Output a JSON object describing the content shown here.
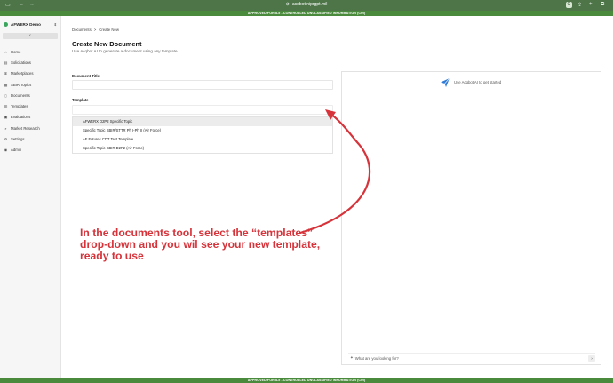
{
  "browser": {
    "url": "acqbot.niprgpt.mil",
    "icons": [
      "sidebar-icon",
      "back-icon",
      "forward-icon",
      "lock-icon",
      "extension-icon",
      "share-icon",
      "new-tab-icon",
      "tabs-icon"
    ],
    "extension_letter": "G"
  },
  "banner": {
    "top": "APPROVED FOR IL5 - CONTROLLED UNCLASSIFIED INFORMATION (CUI)",
    "bottom": "APPROVED FOR IL5 - CONTROLLED UNCLASSIFIED INFORMATION (CUI)"
  },
  "sidebar": {
    "org_name": "AFWERX Demo",
    "collapse_glyph": "‹",
    "items": [
      {
        "label": "Home",
        "icon": "home-icon"
      },
      {
        "label": "Solicitations",
        "icon": "document-icon"
      },
      {
        "label": "Marketplaces",
        "icon": "store-icon"
      },
      {
        "label": "SBIR Topics",
        "icon": "grid-icon"
      },
      {
        "label": "Documents",
        "icon": "file-icon"
      },
      {
        "label": "Templates",
        "icon": "template-icon"
      },
      {
        "label": "Evaluations",
        "icon": "clipboard-icon"
      },
      {
        "label": "Market Research",
        "icon": "search-icon"
      },
      {
        "label": "Settings",
        "icon": "gear-icon"
      },
      {
        "label": "Admin",
        "icon": "user-icon"
      }
    ]
  },
  "breadcrumb": {
    "parent": "Documents",
    "separator": ">",
    "current": "Create New"
  },
  "page": {
    "title": "Create New Document",
    "subtitle": "Use Acqbot AI to generate a document using any template."
  },
  "form": {
    "title_label": "Document Title",
    "title_value": "",
    "template_label": "Template",
    "template_options": [
      "AFWERX D2P2 Specific Topic",
      "Specific Topic SBIR/STTR Ph I-Ph II (Air Force)",
      "AF Futures CDT Test Template",
      "Specific Topic SBIR D2P2 (Air Force)"
    ],
    "highlighted_option_index": 0
  },
  "chat": {
    "hint": "Use Acqbot AI to get started",
    "placeholder": "What are you looking for?",
    "send_glyph": "›"
  },
  "annotation": {
    "text": "In the documents tool, select the “templates” drop-down and you wil see your new template, ready to use",
    "color": "#d6333a"
  },
  "colors": {
    "chrome": "#4d7548",
    "banner": "#4a8a3c",
    "org_dot": "#3aa55d",
    "chat_logo": "#2f7bd8"
  }
}
